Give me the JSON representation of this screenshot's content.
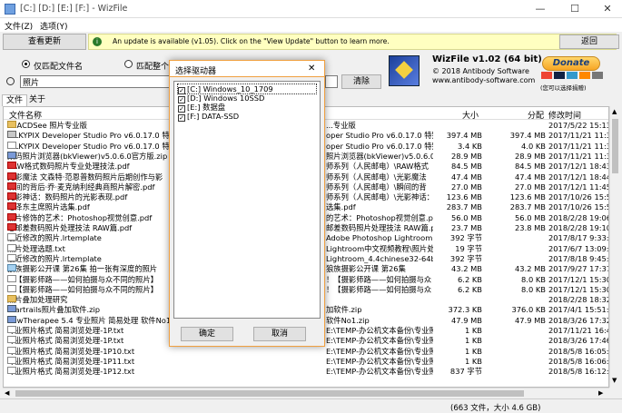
{
  "window": {
    "title": "[C:] [D:] [E:] [F:] - WizFile",
    "minimize": "—",
    "maximize": "☐",
    "close": "✕"
  },
  "menu": {
    "file": "文件(Z)",
    "options": "选项(Y)"
  },
  "update": {
    "view_button": "查看更新",
    "message": "An update is available (v1.05). Click on the \"View Update\" button to learn more.",
    "back_button": "返回"
  },
  "search": {
    "option_name_only": "仅匹配文件名",
    "option_whole_path": "匹配整个",
    "query": "照片",
    "clear_button": "清除"
  },
  "branding": {
    "product": "WizFile v1.02 (64 bit)",
    "copyright": "© 2018 Antibody Software",
    "url": "www.antibody-software.com",
    "donate": "Donate",
    "donate_note": "(您可以选择捐赠)"
  },
  "tabs": {
    "files": "文件",
    "about": "关于"
  },
  "columns": {
    "name": "文件名称",
    "size": "大小",
    "alloc": "分配",
    "modified": "修改时间"
  },
  "rows": [
    {
      "icon": "folder",
      "name": "2. ACDSee 照片专业版",
      "path": "...专业版",
      "size": "",
      "alloc": "",
      "date": "2017/5/22 15:13:20"
    },
    {
      "icon": "exe",
      "name": "SILKYPIX Developer Studio Pro v6.0.17.0 特别版",
      "path": "oper Studio Pro v6.0.17.0 特别",
      "size": "397.4 MB",
      "alloc": "397.4 MB",
      "date": "2017/11/21 11:34:16"
    },
    {
      "icon": "txt",
      "name": "SILKYPIX Developer Studio Pro v6.0.17.0 特别版",
      "path": "oper Studio Pro v6.0.17.0 特别",
      "size": "3.4 KB",
      "alloc": "4.0 KB",
      "date": "2017/11/21 11:37:52"
    },
    {
      "icon": "zip",
      "name": "数码照片浏览器(bkViewer)v5.0.6.0官方版.zip",
      "path": "照片浏览器(bkViewer)v5.0.6.0官方版.",
      "size": "28.9 MB",
      "alloc": "28.9 MB",
      "date": "2017/11/21 11:33:28"
    },
    {
      "icon": "pdf",
      "name": "RAW格式数码照片专业处理技法.pdf",
      "path": "师系列（人民邮电）\\RAW格式",
      "size": "84.5 MB",
      "alloc": "84.5 MB",
      "date": "2017/12/1 18:43:49"
    },
    {
      "icon": "pdf",
      "name": "光影魔法 文森特·范恩普数码照片后期创作与影",
      "path": "师系列（人民邮电）\\光影魔法",
      "size": "47.4 MB",
      "alloc": "47.4 MB",
      "date": "2017/12/1 18:44:12"
    },
    {
      "icon": "pdf",
      "name": "瞬间的背后·乔·麦克纳利经典商照片解密.pdf",
      "path": "师系列（人民邮电）\\瞬间的背",
      "size": "27.0 MB",
      "alloc": "27.0 MB",
      "date": "2017/12/1 11:45:53"
    },
    {
      "icon": "pdf",
      "name": "光影神话：数码照片的光影表现.pdf",
      "path": "师系列（人民邮电）\\光影神话：数码照片的光影表现.pdf",
      "size": "123.6 MB",
      "alloc": "123.6 MB",
      "date": "2017/10/26 15:51:08"
    },
    {
      "icon": "pdf",
      "name": "毛泽东主席照片选集.pdf",
      "path": "选集.pdf",
      "size": "283.7 MB",
      "alloc": "283.7 MB",
      "date": "2017/10/26 15:54:22"
    },
    {
      "icon": "pdf",
      "name": "照片修饰的艺术：Photoshop视觉创意.pdf",
      "path": "的艺术：Photoshop视觉创意.pdf",
      "size": "56.0 MB",
      "alloc": "56.0 MB",
      "date": "2018/2/28 19:06:44"
    },
    {
      "icon": "pdf",
      "name": "老邮差数码照片处理技法 RAW篇.pdf",
      "path": "邮差数码照片处理技法 RAW篇.pdf",
      "size": "23.7 MB",
      "alloc": "23.8 MB",
      "date": "2018/2/28 19:10:35"
    },
    {
      "icon": "txt",
      "name": "最近修改的照片.lrtemplate",
      "path": "Adobe Photoshop Lightroom CC",
      "size": "392 字节",
      "alloc": "",
      "date": "2017/8/17 9:33:51"
    },
    {
      "icon": "txt",
      "name": "照片处理选题.txt",
      "path": "Lightroom中文视频教程\\照片处",
      "size": "19 字节",
      "alloc": "",
      "date": "2017/6/7 13:09:36"
    },
    {
      "icon": "txt",
      "name": "最近修改的照片.lrtemplate",
      "path": "Lightroom_4.4chinese32-64bit",
      "size": "392 字节",
      "alloc": "",
      "date": "2017/8/18 9:45:59"
    },
    {
      "icon": "img",
      "name": "狼族摄影公开课 第26集 拍一张有深度的照片",
      "path": "狼族摄影公开课 第26集",
      "size": "43.2 MB",
      "alloc": "43.2 MB",
      "date": "2017/9/27 17:37:01"
    },
    {
      "icon": "txt",
      "name": "！【摄影师路——如何拍摄与众不同的照片】",
      "path": "！【摄影师路——如何拍摄与众",
      "size": "6.2 KB",
      "alloc": "8.0 KB",
      "date": "2017/12/1 15:30:58"
    },
    {
      "icon": "txt",
      "name": "！【摄影师路——如何拍摄与众不同的照片】",
      "path": "！【摄影师路——如何拍摄与众",
      "size": "6.2 KB",
      "alloc": "8.0 KB",
      "date": "2017/12/1 15:30:58"
    },
    {
      "icon": "folder",
      "name": "照片叠加处理研究",
      "path": "",
      "size": "",
      "alloc": "",
      "date": "2018/2/28 18:32:50"
    },
    {
      "icon": "zip",
      "name": "Startrails照片叠加软件.zip",
      "path": "加软件.zip",
      "size": "372.3 KB",
      "alloc": "376.0 KB",
      "date": "2017/4/1 15:51:55"
    },
    {
      "icon": "zip",
      "name": "RawTherapee 5.4 专业照片 简易处理 软件No1.zip",
      "path": "软件No1.zip",
      "size": "47.9 MB",
      "alloc": "47.9 MB",
      "date": "2018/3/26 17:32:20"
    },
    {
      "icon": "txt",
      "name": "专业照片格式 简易浏览处理-1P.txt",
      "path": "E:\\TEMP-办公机文本备份\\专业照片格式 简易浏览处理-1P.txt",
      "size": "1 KB",
      "alloc": "",
      "date": "2017/11/21 16:44:41"
    },
    {
      "icon": "txt",
      "name": "专业照片格式 简易浏览处理-1P.txt",
      "path": "E:\\TEMP-办公机文本备份\\专业照片格式 简易浏览处理-1P1.txt",
      "size": "1 KB",
      "alloc": "",
      "date": "2018/3/26 17:46:29"
    },
    {
      "icon": "txt",
      "name": "专业照片格式 简易浏览处理-1P10.txt",
      "path": "E:\\TEMP-办公机文本备份\\专业照片格式 简易浏览处理-1P10.txt",
      "size": "1 KB",
      "alloc": "",
      "date": "2018/5/8 16:05:44"
    },
    {
      "icon": "txt",
      "name": "专业照片格式 简易浏览处理-1P11.txt",
      "path": "E:\\TEMP-办公机文本备份\\专业照片格式 简易浏览处理-1P11.txt",
      "size": "1 KB",
      "alloc": "",
      "date": "2018/5/8 16:06:24"
    },
    {
      "icon": "txt",
      "name": "专业照片格式 简易浏览处理-1P12.txt",
      "path": "E:\\TEMP-办公机文本备份\\专业照片格式 简易浏览处理-1P12.txt",
      "size": "837 字节",
      "alloc": "",
      "date": "2018/5/8 16:12:13"
    }
  ],
  "status": {
    "text": "(663 文件，大小 4.6 GB)"
  },
  "dialog": {
    "title": "选择驱动器",
    "close": "✕",
    "drives": [
      {
        "label": "[C:] Windows_10_1709",
        "checked": true
      },
      {
        "label": "[D:] Windows 10SSD",
        "checked": true
      },
      {
        "label": "[E:] 数据盘",
        "checked": true
      },
      {
        "label": "[F:] DATA-SSD",
        "checked": true
      }
    ],
    "ok": "确定",
    "cancel": "取消"
  }
}
